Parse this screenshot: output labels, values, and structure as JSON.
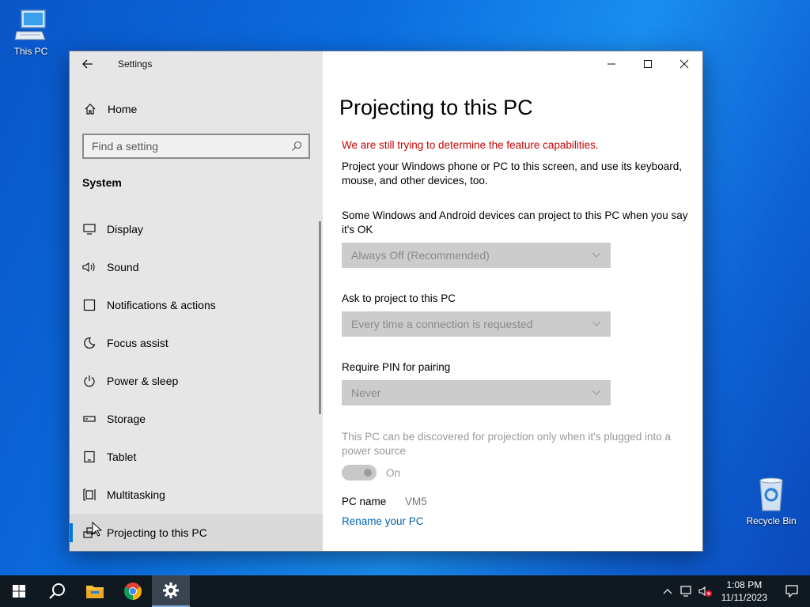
{
  "desktop": {
    "this_pc_label": "This PC",
    "recycle_bin_label": "Recycle Bin"
  },
  "window": {
    "app_title": "Settings",
    "controls": [
      "minimize-icon",
      "maximize-icon",
      "close-icon"
    ]
  },
  "sidebar": {
    "home_label": "Home",
    "search_placeholder": "Find a setting",
    "section_label": "System",
    "items": [
      {
        "label": "Display",
        "icon": "display-icon"
      },
      {
        "label": "Sound",
        "icon": "speaker-icon"
      },
      {
        "label": "Notifications & actions",
        "icon": "notification-icon"
      },
      {
        "label": "Focus assist",
        "icon": "moon-icon"
      },
      {
        "label": "Power & sleep",
        "icon": "power-icon"
      },
      {
        "label": "Storage",
        "icon": "storage-icon"
      },
      {
        "label": "Tablet",
        "icon": "tablet-icon"
      },
      {
        "label": "Multitasking",
        "icon": "multitasking-icon"
      },
      {
        "label": "Projecting to this PC",
        "icon": "projecting-icon",
        "active": true
      }
    ]
  },
  "main": {
    "title": "Projecting to this PC",
    "warning": "We are still trying to determine the feature capabilities.",
    "description": "Project your Windows phone or PC to this screen, and use its keyboard, mouse, and other devices, too.",
    "projection_prompt": "Some Windows and Android devices can project to this PC when you say it's OK",
    "projection_value": "Always Off (Recommended)",
    "ask_label": "Ask to project to this PC",
    "ask_value": "Every time a connection is requested",
    "pin_label": "Require PIN for pairing",
    "pin_value": "Never",
    "power_note": "This PC can be discovered for projection only when it's plugged into a power source",
    "toggle_label": "On",
    "pc_name_key": "PC name",
    "pc_name_value": "VM5",
    "rename_link": "Rename your PC"
  },
  "taskbar": {
    "time": "1:08 PM",
    "date": "11/11/2023",
    "pinned": [
      "windows-start-icon",
      "search-icon",
      "file-explorer-icon",
      "chrome-icon",
      "settings-gear-icon"
    ]
  },
  "colors": {
    "accent": "#0078d7",
    "warning": "#c50500",
    "link": "#0063b1"
  }
}
